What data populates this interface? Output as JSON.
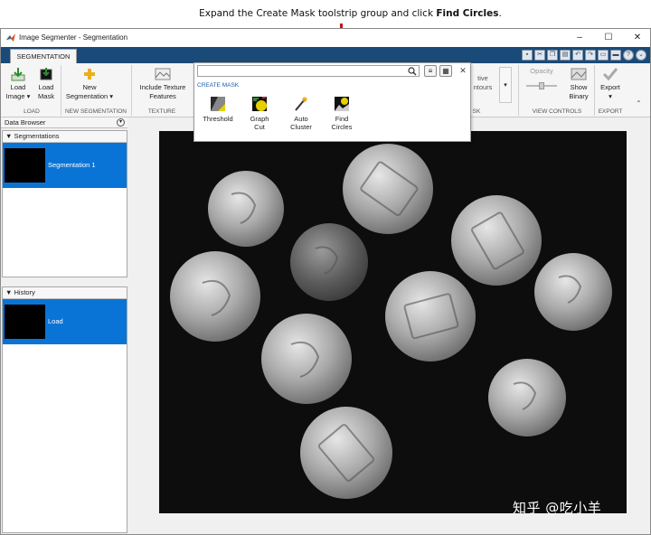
{
  "caption": {
    "prefix": "Expand the Create Mask toolstrip group and click ",
    "emphasis": "Find Circles",
    "suffix": "."
  },
  "window": {
    "title": "Image Segmenter - Segmentation",
    "controls": {
      "minimize": "–",
      "maximize": "☐",
      "close": "✕"
    }
  },
  "ribbon": {
    "tab": "SEGMENTATION",
    "groups": {
      "load": "LOAD",
      "new_segmentation": "NEW SEGMENTATION",
      "texture": "TEXTURE",
      "create_mask_partial": "SK",
      "view_controls": "VIEW CONTROLS",
      "export": "EXPORT"
    },
    "buttons": {
      "load_image": [
        "Load",
        "Image ▾"
      ],
      "load_mask": [
        "Load",
        "Mask"
      ],
      "new_segmentation": [
        "New",
        "Segmentation ▾"
      ],
      "include_texture": [
        "Include Texture",
        "Features"
      ],
      "active_contours": [
        "tive",
        "ntours"
      ],
      "opacity": "Opacity",
      "show_binary": [
        "Show",
        "Binary"
      ],
      "export": [
        "Export",
        "▾"
      ]
    }
  },
  "gallery": {
    "section": "CREATE MASK",
    "items": [
      {
        "label": [
          "Threshold",
          ""
        ],
        "icon": "threshold-icon"
      },
      {
        "label": [
          "Graph",
          "Cut"
        ],
        "icon": "graph-cut-icon"
      },
      {
        "label": [
          "Auto",
          "Cluster"
        ],
        "icon": "auto-cluster-icon"
      },
      {
        "label": [
          "Find",
          "Circles"
        ],
        "icon": "find-circles-icon"
      }
    ]
  },
  "data_browser": {
    "title": "Data Browser",
    "segmentations": {
      "title": "Segmentations",
      "items": [
        "Segmentation 1"
      ]
    },
    "history": {
      "title": "History",
      "items": [
        "Load"
      ]
    }
  },
  "watermark": "知乎 @吃小羊",
  "colors": {
    "accent": "#0a74d6",
    "tabstrip": "#1a4a78",
    "arrow": "#c0141c"
  }
}
